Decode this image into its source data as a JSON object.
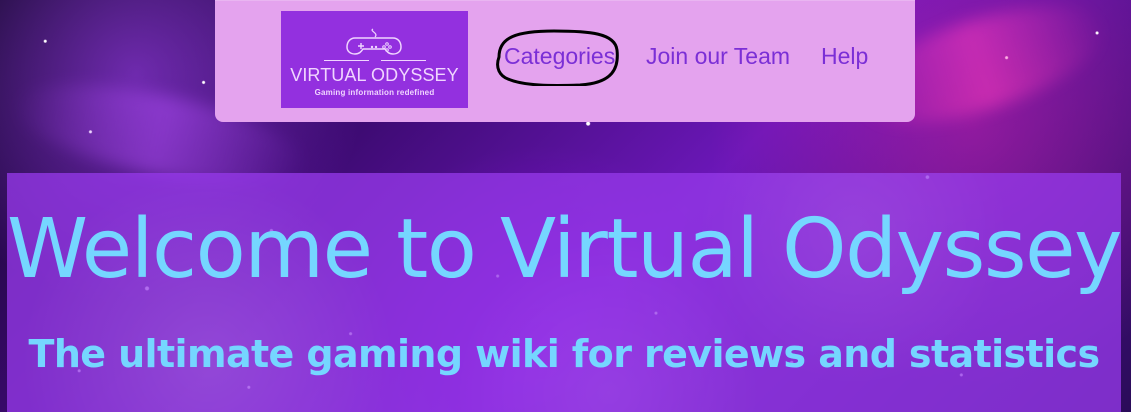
{
  "colors": {
    "nav_background": "#e4a3ee",
    "logo_background": "#9330df",
    "logo_text": "#f0d5ff",
    "nav_link": "#7b2fd6",
    "hero_background": "#9539e8",
    "hero_text": "#75d6ff",
    "annotation_outline": "#000000"
  },
  "header": {
    "logo": {
      "icon": "gamepad-icon",
      "title": "VIRTUAL ODYSSEY",
      "tagline": "Gaming information redefined"
    },
    "nav": [
      {
        "label": "Categories"
      },
      {
        "label": "Join our Team"
      },
      {
        "label": "Help"
      }
    ],
    "annotation": "circle-highlight"
  },
  "hero": {
    "title": "Welcome to Virtual Odyssey",
    "subtitle": "The ultimate gaming wiki for reviews and statistics"
  }
}
